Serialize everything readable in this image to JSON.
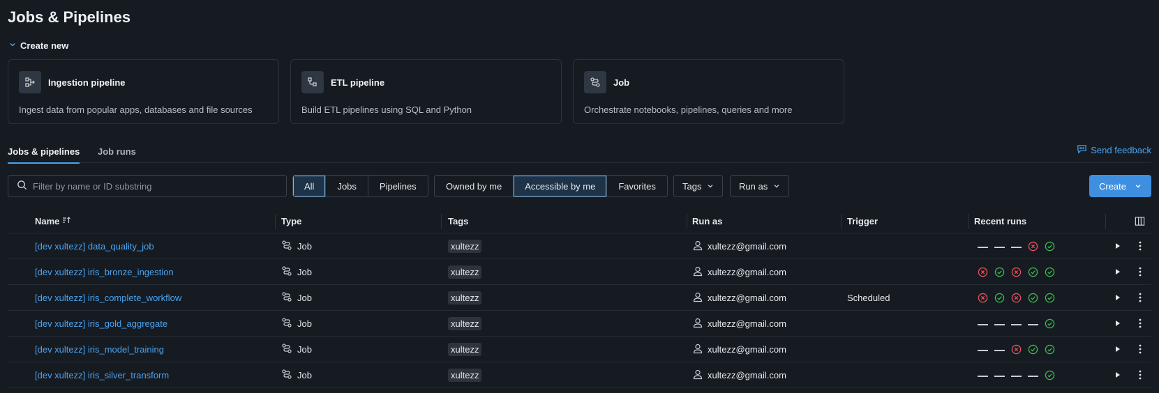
{
  "page_title": "Jobs & Pipelines",
  "create_new_label": "Create new",
  "cards": [
    {
      "title": "Ingestion pipeline",
      "desc": "Ingest data from popular apps, databases and file sources",
      "icon": "ingestion-icon"
    },
    {
      "title": "ETL pipeline",
      "desc": "Build ETL pipelines using SQL and Python",
      "icon": "etl-icon"
    },
    {
      "title": "Job",
      "desc": "Orchestrate notebooks, pipelines, queries and more",
      "icon": "job-icon"
    }
  ],
  "tabs": [
    {
      "label": "Jobs & pipelines",
      "active": true
    },
    {
      "label": "Job runs",
      "active": false
    }
  ],
  "feedback_label": "Send feedback",
  "search": {
    "placeholder": "Filter by name or ID substring",
    "value": ""
  },
  "type_filter": {
    "options": [
      "All",
      "Jobs",
      "Pipelines"
    ],
    "selected": "All"
  },
  "owner_filter": {
    "options": [
      "Owned by me",
      "Accessible by me",
      "Favorites"
    ],
    "selected": "Accessible by me"
  },
  "tags_dropdown": "Tags",
  "runas_dropdown": "Run as",
  "create_button": "Create",
  "columns": {
    "name": "Name",
    "type": "Type",
    "tags": "Tags",
    "run_as": "Run as",
    "trigger": "Trigger",
    "recent_runs": "Recent runs"
  },
  "colors": {
    "accent": "#4aa3f0",
    "success": "#3fb950",
    "failure": "#f0505a"
  },
  "rows": [
    {
      "name": "[dev xultezz] data_quality_job",
      "type": "Job",
      "tag": "xultezz",
      "run_as": "xultezz@gmail.com",
      "trigger": "",
      "runs": [
        "none",
        "none",
        "none",
        "fail",
        "success"
      ]
    },
    {
      "name": "[dev xultezz] iris_bronze_ingestion",
      "type": "Job",
      "tag": "xultezz",
      "run_as": "xultezz@gmail.com",
      "trigger": "",
      "runs": [
        "fail",
        "success",
        "fail",
        "success",
        "success"
      ]
    },
    {
      "name": "[dev xultezz] iris_complete_workflow",
      "type": "Job",
      "tag": "xultezz",
      "run_as": "xultezz@gmail.com",
      "trigger": "Scheduled",
      "runs": [
        "fail",
        "success",
        "fail",
        "success",
        "success"
      ]
    },
    {
      "name": "[dev xultezz] iris_gold_aggregate",
      "type": "Job",
      "tag": "xultezz",
      "run_as": "xultezz@gmail.com",
      "trigger": "",
      "runs": [
        "none",
        "none",
        "none",
        "none",
        "success"
      ]
    },
    {
      "name": "[dev xultezz] iris_model_training",
      "type": "Job",
      "tag": "xultezz",
      "run_as": "xultezz@gmail.com",
      "trigger": "",
      "runs": [
        "none",
        "none",
        "fail",
        "success",
        "success"
      ]
    },
    {
      "name": "[dev xultezz] iris_silver_transform",
      "type": "Job",
      "tag": "xultezz",
      "run_as": "xultezz@gmail.com",
      "trigger": "",
      "runs": [
        "none",
        "none",
        "none",
        "none",
        "success"
      ]
    }
  ]
}
